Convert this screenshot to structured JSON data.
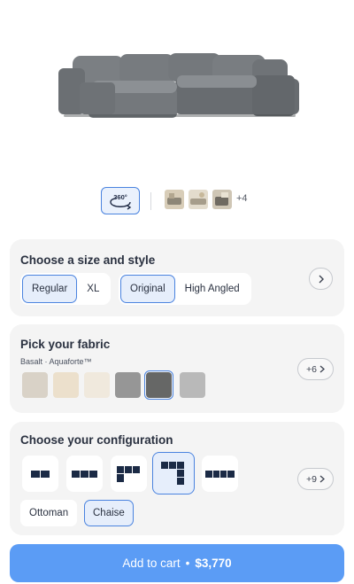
{
  "product_view": {
    "btn_360_label": "360°",
    "more_thumbs": "+4"
  },
  "size_section": {
    "title": "Choose a size and style",
    "size_options": [
      "Regular",
      "XL"
    ],
    "style_options": [
      "Original",
      "High Angled"
    ]
  },
  "fabric_section": {
    "title": "Pick your fabric",
    "selected_fabric": "Basalt · Aquaforte™",
    "more_label": "+6",
    "swatch_colors": [
      "#d9d2c7",
      "#ece0cc",
      "#f0e9dd",
      "#969696",
      "#666766",
      "#b9b9b9"
    ]
  },
  "config_section": {
    "title": "Choose your configuration",
    "more_label": "+9",
    "chips": [
      "Ottoman",
      "Chaise"
    ]
  },
  "cart": {
    "label": "Add to cart",
    "separator": "•",
    "price": "$3,770"
  },
  "colors": {
    "accent": "#4a83df",
    "cart_button": "#5b9cf5"
  }
}
